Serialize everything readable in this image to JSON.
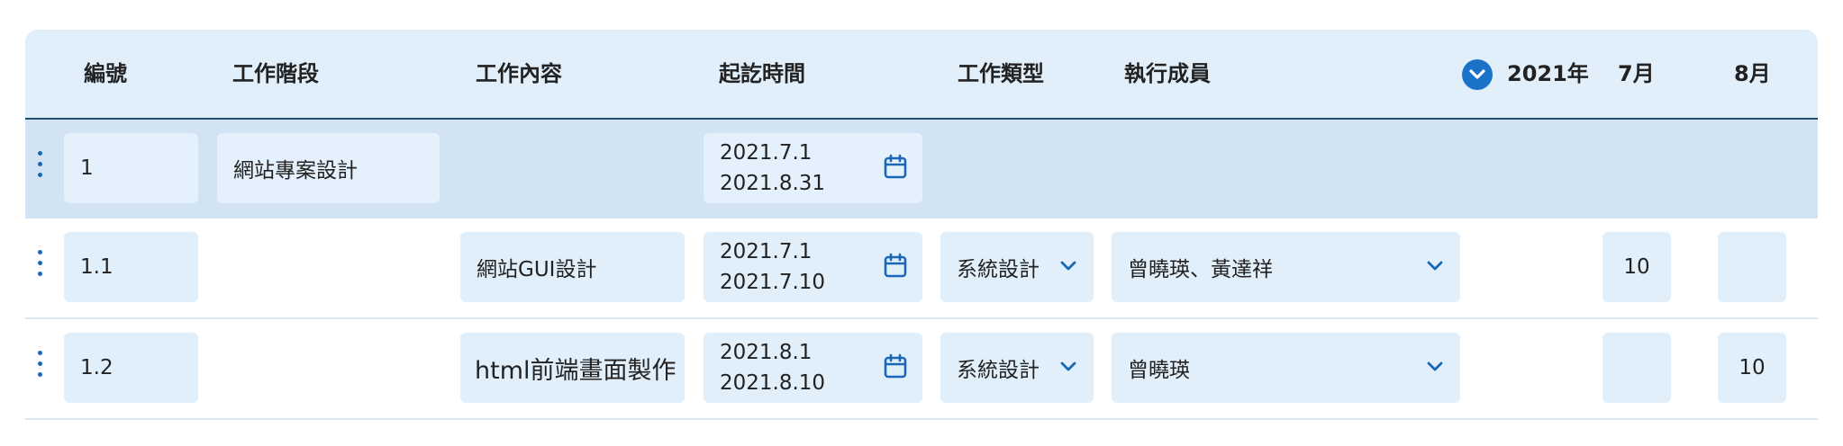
{
  "header": {
    "col_id": "編號",
    "col_stage": "工作階段",
    "col_content": "工作內容",
    "col_period": "起訖時間",
    "col_type": "工作類型",
    "col_members": "執行成員",
    "year": "2021年",
    "months": [
      "7月",
      "8月"
    ]
  },
  "rows": [
    {
      "id": "1",
      "stage": "網站專案設計",
      "start": "2021.7.1",
      "end": "2021.8.31"
    },
    {
      "id": "1.1",
      "content": "網站GUI設計",
      "start": "2021.7.1",
      "end": "2021.7.10",
      "type": "系統設計",
      "members": "曾曉瑛、黃達祥",
      "jul": "10",
      "aug": ""
    },
    {
      "id": "1.2",
      "content": "html前端畫面製作",
      "start": "2021.8.1",
      "end": "2021.8.10",
      "type": "系統設計",
      "members": "曾曉瑛",
      "jul": "",
      "aug": "10"
    }
  ],
  "icons": {
    "drag": "drag-handle-icon",
    "calendar": "calendar-icon",
    "chevron": "chevron-down-icon"
  },
  "colors": {
    "header_bg": "#e1effb",
    "group_row_bg": "#d2e4f4",
    "field_bg": "#e1effb",
    "accent": "#1a73c8",
    "icon": "#1a67b5"
  }
}
